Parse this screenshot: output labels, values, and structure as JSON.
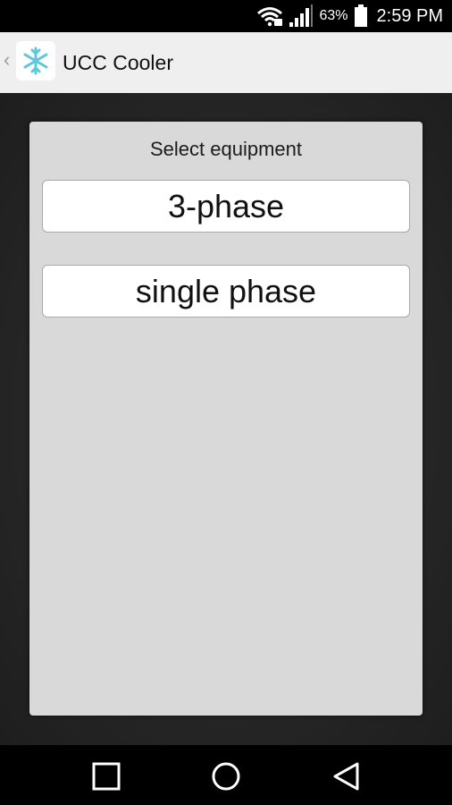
{
  "status_bar": {
    "battery_percent": "63%",
    "time": "2:59 PM",
    "icons": [
      "wifi-icon",
      "signal-icon",
      "battery-icon"
    ]
  },
  "action_bar": {
    "title": "UCC Cooler",
    "app_icon": "snowflake-icon",
    "back_icon": "chevron-left-icon"
  },
  "panel": {
    "title": "Select equipment",
    "buttons": [
      {
        "label": "3-phase"
      },
      {
        "label": "single phase"
      }
    ]
  },
  "nav_bar": {
    "icons": [
      "recents-icon",
      "home-icon",
      "back-icon"
    ]
  },
  "colors": {
    "accent": "#5cc8d8",
    "panel_bg": "#d9d9d9",
    "action_bar_bg": "#efefef"
  }
}
